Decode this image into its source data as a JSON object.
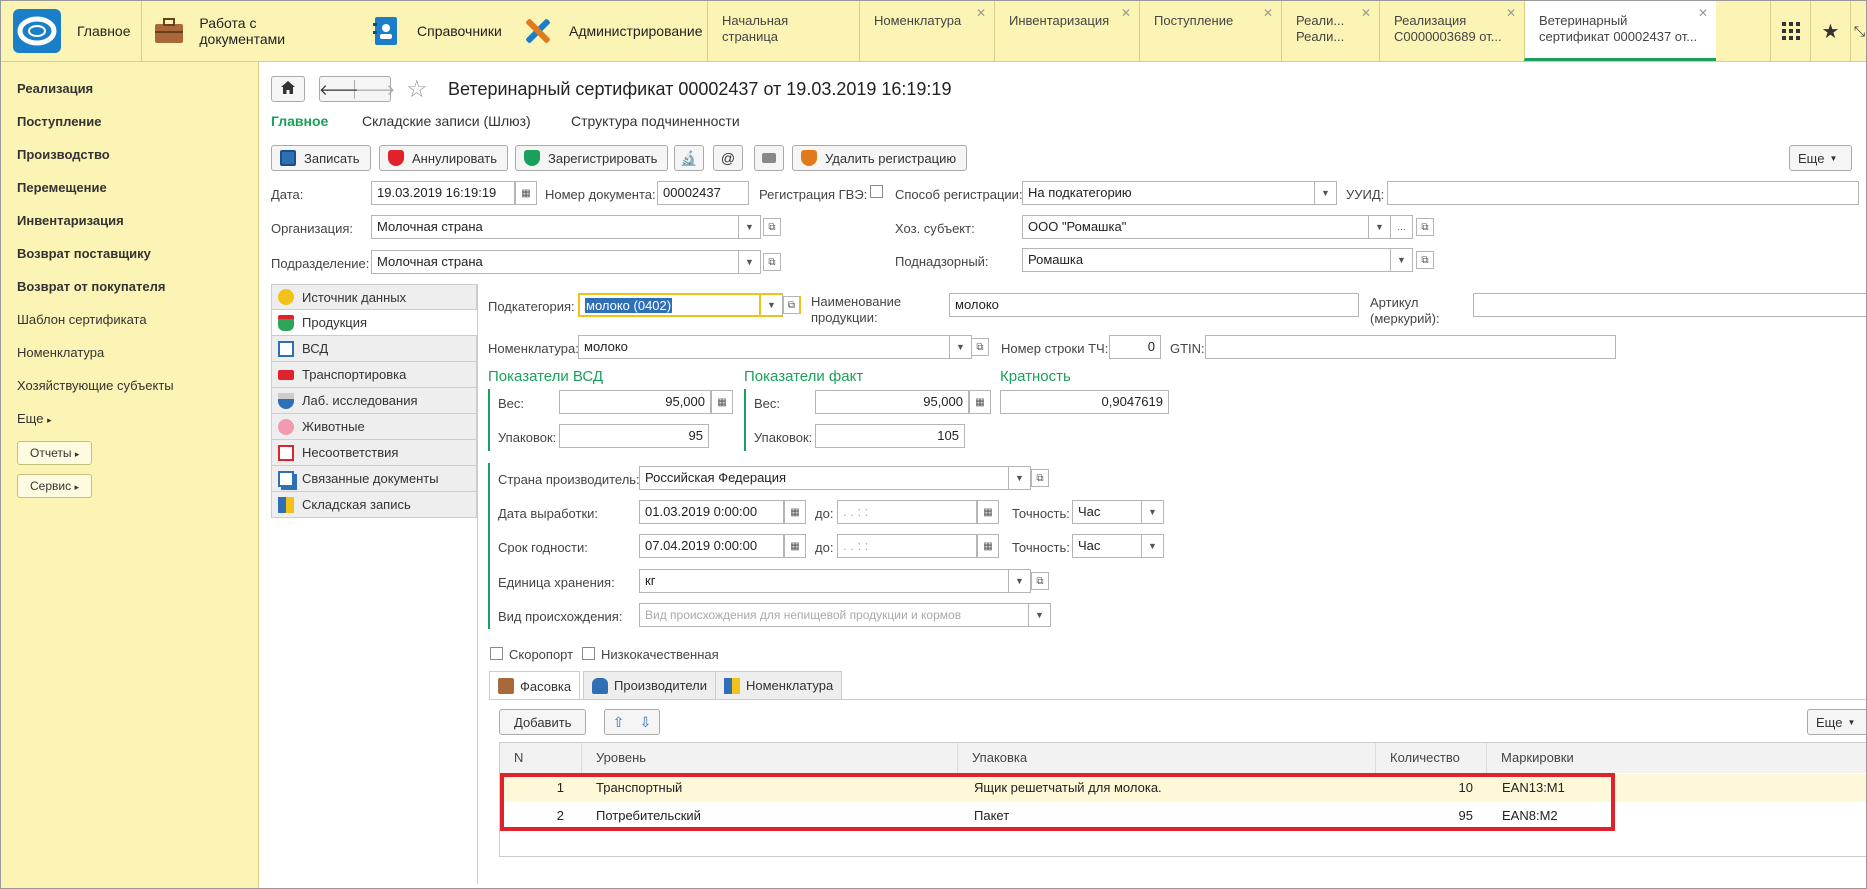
{
  "topbar": {
    "sections": [
      {
        "label": "Главное"
      },
      {
        "label": "Работа с документами"
      },
      {
        "label": "Справочники"
      },
      {
        "label": "Администрирование"
      }
    ],
    "tabs": [
      {
        "line1": "Начальная страница",
        "line2": "",
        "closable": false
      },
      {
        "line1": "Номенклатура",
        "line2": "",
        "closable": true
      },
      {
        "line1": "Инвентаризация",
        "line2": "",
        "closable": true
      },
      {
        "line1": "Поступление",
        "line2": "",
        "closable": true
      },
      {
        "line1": "Реали...",
        "line2": "Реали...",
        "closable": true
      },
      {
        "line1": "Реализация",
        "line2": "С0000003689 от...",
        "closable": true
      },
      {
        "line1": "Ветеринарный",
        "line2": "сертификат 00002437 от...",
        "closable": true
      }
    ]
  },
  "sidebar": {
    "items": [
      {
        "label": "Реализация",
        "bold": true
      },
      {
        "label": "Поступление",
        "bold": true
      },
      {
        "label": "Производство",
        "bold": true
      },
      {
        "label": "Перемещение",
        "bold": true
      },
      {
        "label": "Инвентаризация",
        "bold": true
      },
      {
        "label": "Возврат поставщику",
        "bold": true
      },
      {
        "label": "Возврат от покупателя",
        "bold": true
      },
      {
        "label": "Шаблон сертификата",
        "bold": false
      },
      {
        "label": "Номенклатура",
        "bold": false
      },
      {
        "label": "Хозяйствующие субъекты",
        "bold": false
      }
    ],
    "more": "Еще",
    "reports": "Отчеты",
    "service": "Сервис"
  },
  "doc": {
    "title": "Ветеринарный сертификат 00002437 от 19.03.2019 16:19:19",
    "subtabs": [
      "Главное",
      "Складские записи (Шлюз)",
      "Структура подчиненности"
    ],
    "toolbar": {
      "save": "Записать",
      "annul": "Аннулировать",
      "register": "Зарегистрировать",
      "delete_reg": "Удалить регистрацию",
      "more": "Еще"
    },
    "fields": {
      "date_label": "Дата:",
      "date": "19.03.2019 16:19:19",
      "docnum_label": "Номер документа:",
      "docnum": "00002437",
      "gvz_label": "Регистрация ГВЭ:",
      "regmode_label": "Способ регистрации:",
      "regmode": "На подкатегорию",
      "uuid_label": "УУИД:",
      "uuid": "",
      "org_label": "Организация:",
      "org": "Молочная страна",
      "hoz_label": "Хоз. субъект:",
      "hoz": "ООО \"Ромашка\"",
      "div_label": "Подразделение:",
      "div": "Молочная страна",
      "supervised_label": "Поднадзорный:",
      "supervised": "Ромашка"
    },
    "leftpanel": [
      "Источник данных",
      "Продукция",
      "ВСД",
      "Транспортировка",
      "Лаб. исследования",
      "Животные",
      "Несоответствия",
      "Связанные документы",
      "Складская запись"
    ],
    "product": {
      "subcat_label": "Подкатегория:",
      "subcat": "молоко (0402)",
      "prodname_label1": "Наименование",
      "prodname_label2": "продукции:",
      "prodname": "молоко",
      "article_label1": "Артикул",
      "article_label2": "(меркурий):",
      "article": "",
      "nom_label": "Номенклатура:",
      "nom": "молоко",
      "rownum_label": "Номер строки ТЧ:",
      "rownum": "0",
      "gtin_label": "GTIN:",
      "gtin": "",
      "vsd_title": "Показатели ВСД",
      "fact_title": "Показатели факт",
      "mult_title": "Кратность",
      "weight_label": "Вес:",
      "packs_label": "Упаковок:",
      "vsd_weight": "95,000",
      "vsd_packs": "95",
      "fact_weight": "95,000",
      "fact_packs": "105",
      "multiplicity": "0,9047619",
      "country_label": "Страна производитель:",
      "country": "Российская Федерация",
      "prod_date_label": "Дата выработки:",
      "prod_date": "01.03.2019  0:00:00",
      "exp_date_label": "Срок годности:",
      "exp_date": "07.04.2019  0:00:00",
      "to_label": "до:",
      "to_placeholder": " .  .       :  :",
      "accuracy_label": "Точность:",
      "accuracy": "Час",
      "unit_label": "Единица хранения:",
      "unit": "кг",
      "origin_label": "Вид происхождения:",
      "origin_placeholder": "Вид происхождения для непищевой продукции и кормов",
      "perishable": "Скоропорт",
      "lowquality": "Низкокачественная"
    },
    "bottomtabs": [
      "Фасовка",
      "Производители",
      "Номенклатура"
    ],
    "add": "Добавить",
    "more2": "Еще",
    "table": {
      "columns": [
        "N",
        "Уровень",
        "Упаковка",
        "Количество",
        "Маркировки"
      ],
      "rows": [
        {
          "n": "1",
          "level": "Транспортный",
          "pack": "Ящик решетчатый для молока.",
          "qty": "10",
          "marks": "EAN13:M1"
        },
        {
          "n": "2",
          "level": "Потребительский",
          "pack": "Пакет",
          "qty": "95",
          "marks": "EAN8:M2"
        }
      ]
    }
  }
}
